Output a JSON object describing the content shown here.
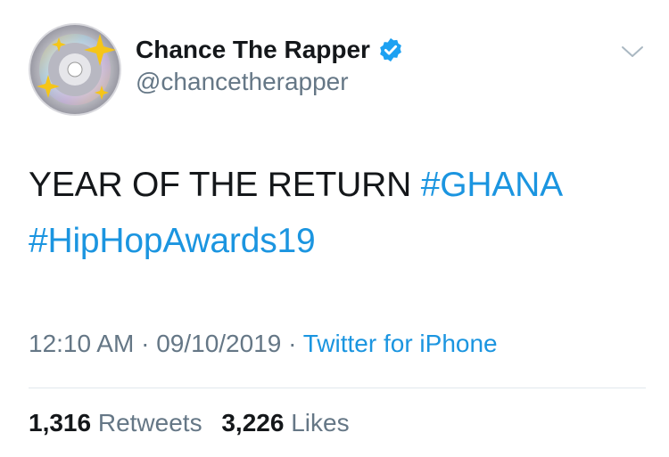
{
  "author": {
    "display_name": "Chance The Rapper",
    "handle": "@chancetherapper",
    "verified": true,
    "avatar_icon": "sparkling-cd-icon"
  },
  "tweet": {
    "text_plain": "YEAR OF THE RETURN ",
    "hashtags": [
      "#GHANA",
      "#HipHopAwards19"
    ]
  },
  "meta": {
    "time": "12:10 AM",
    "separator": "·",
    "date": "09/10/2019",
    "source": "Twitter for iPhone"
  },
  "stats": {
    "retweets_count": "1,316",
    "retweets_label": "Retweets",
    "likes_count": "3,226",
    "likes_label": "Likes"
  },
  "colors": {
    "link": "#1b95e0",
    "secondary_text": "#657786",
    "primary_text": "#14171a"
  }
}
